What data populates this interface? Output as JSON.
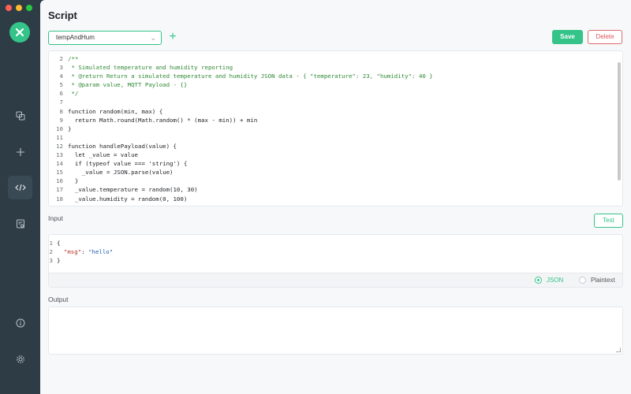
{
  "window": {
    "traffic_lights": [
      "#ff5f57",
      "#febc2e",
      "#28c840"
    ]
  },
  "sidebar": {
    "logo_icon": "x-logo-icon",
    "items": [
      {
        "name": "connections",
        "icon": "copy-icon"
      },
      {
        "name": "new-connection",
        "icon": "plus-icon"
      },
      {
        "name": "script",
        "icon": "code-icon",
        "active": true
      },
      {
        "name": "log",
        "icon": "log-icon"
      },
      {
        "name": "about",
        "icon": "info-icon"
      },
      {
        "name": "settings",
        "icon": "gear-icon"
      }
    ]
  },
  "header": {
    "title": "Script"
  },
  "toolbar": {
    "script_select_value": "tempAndHum",
    "save_label": "Save",
    "delete_label": "Delete"
  },
  "editor": {
    "lines": [
      {
        "n": "2",
        "text": "/**",
        "cls": "comment"
      },
      {
        "n": "3",
        "text": " * Simulated temperature and humidity reporting",
        "cls": "comment"
      },
      {
        "n": "4",
        "text": " * @return Return a simulated temperature and humidity JSON data - { \"temperature\": 23, \"humidity\": 40 }",
        "cls": "comment"
      },
      {
        "n": "5",
        "text": " * @param value, MQTT Payload - {}",
        "cls": "comment"
      },
      {
        "n": "6",
        "text": " */",
        "cls": "comment"
      },
      {
        "n": "7",
        "text": "",
        "cls": "tx"
      },
      {
        "n": "8",
        "text": "function random(min, max) {",
        "cls": "tx"
      },
      {
        "n": "9",
        "text": "  return Math.round(Math.random() * (max - min)) + min",
        "cls": "tx"
      },
      {
        "n": "10",
        "text": "}",
        "cls": "tx"
      },
      {
        "n": "11",
        "text": "",
        "cls": "tx"
      },
      {
        "n": "12",
        "text": "function handlePayload(value) {",
        "cls": "tx"
      },
      {
        "n": "13",
        "text": "  let _value = value",
        "cls": "tx"
      },
      {
        "n": "14",
        "text": "  if (typeof value === 'string') {",
        "cls": "tx"
      },
      {
        "n": "15",
        "text": "    _value = JSON.parse(value)",
        "cls": "tx"
      },
      {
        "n": "16",
        "text": "  }",
        "cls": "tx"
      },
      {
        "n": "17",
        "text": "  _value.temperature = random(10, 30)",
        "cls": "tx"
      },
      {
        "n": "18",
        "text": "  _value.humidity = random(0, 100)",
        "cls": "tx"
      }
    ]
  },
  "input": {
    "label": "Input",
    "test_label": "Test",
    "line_numbers": [
      "1",
      "2",
      "3"
    ],
    "open_brace": "{",
    "key": "\"msg\"",
    "colon": ": ",
    "value": "\"hello\"",
    "close_brace": "}",
    "formats": {
      "json": "JSON",
      "plaintext": "Plaintext",
      "selected": "JSON"
    }
  },
  "output": {
    "label": "Output"
  }
}
